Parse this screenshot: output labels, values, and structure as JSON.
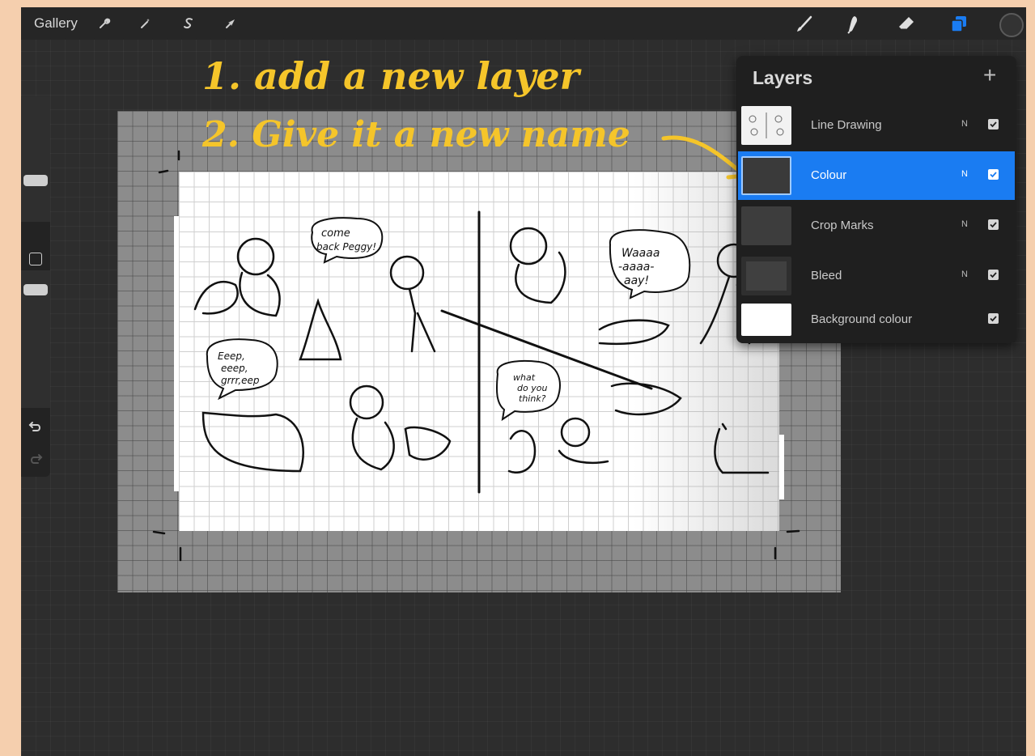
{
  "topbar": {
    "gallery_label": "Gallery",
    "left_tools": [
      "wrench-icon",
      "magic-wand-icon",
      "selection-s-icon",
      "transform-arrow-icon"
    ],
    "right_tools": [
      "brush-icon",
      "smudge-icon",
      "eraser-icon",
      "layers-icon",
      "color-picker-icon"
    ],
    "active_tool": "layers-icon",
    "accent_color": "#1a7cf2"
  },
  "sidebar": {
    "brush_size_level": 0.28,
    "opacity_level": 0.62,
    "buttons": [
      "modify-square-icon",
      "undo-icon",
      "redo-icon"
    ]
  },
  "annotations": {
    "line1": "1. add a new layer",
    "line2": "2. Give it a new name",
    "color": "#f5c52a"
  },
  "layers": {
    "title": "Layers",
    "add_icon": "plus-icon",
    "items": [
      {
        "name": "Line Drawing",
        "mode": "N",
        "visible": true,
        "selected": false
      },
      {
        "name": "Colour",
        "mode": "N",
        "visible": true,
        "selected": true
      },
      {
        "name": "Crop Marks",
        "mode": "N",
        "visible": true,
        "selected": false
      },
      {
        "name": "Bleed",
        "mode": "N",
        "visible": true,
        "selected": false
      },
      {
        "name": "Background colour",
        "mode": "",
        "visible": true,
        "selected": false
      }
    ]
  },
  "canvas": {
    "speech_bubbles": [
      "come back Peggy!",
      "Waaaa -aaaa- aay!",
      "Eeep, eeep, grrr, eep",
      "what do you think?"
    ]
  }
}
